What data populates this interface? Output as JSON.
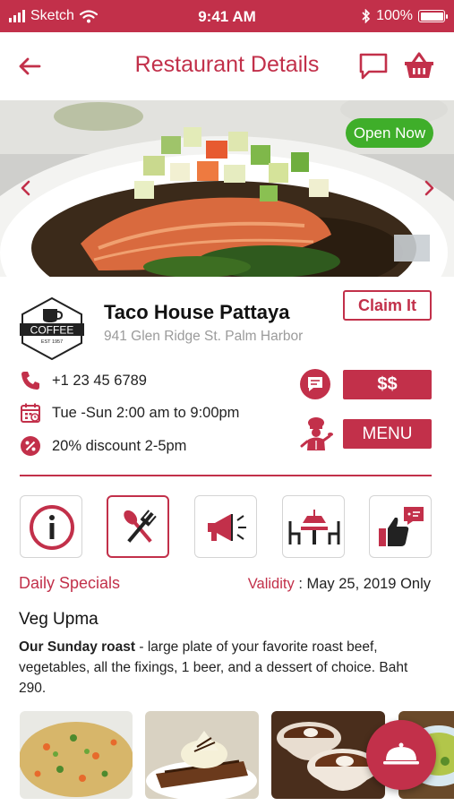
{
  "status": {
    "carrier": "Sketch",
    "time": "9:41 AM",
    "battery": "100%"
  },
  "nav": {
    "title": "Restaurant Details"
  },
  "hero": {
    "badge": "Open Now"
  },
  "restaurant": {
    "logo_text": "COFFEE",
    "logo_sub": "EST 1957",
    "name": "Taco House Pattaya",
    "address": "941 Glen Ridge St. Palm Harbor",
    "claim_label": "Claim It",
    "phone": "+1 23 45 6789",
    "hours": "Tue -Sun 2:00 am to 9:00pm",
    "discount": "20% discount 2-5pm",
    "price_label": "$$",
    "menu_label": "MENU"
  },
  "icons": {
    "tiles": [
      "info-icon",
      "cutlery-icon",
      "megaphone-icon",
      "table-icon",
      "thumbs-up-icon"
    ],
    "fab": "cloche-icon"
  },
  "specials": {
    "title": "Daily Specials",
    "validity_label": "Validity",
    "validity_sep": " : ",
    "validity_value": "May 25, 2019 Only",
    "dish_name": "Veg Upma",
    "dish_lead": "Our Sunday roast",
    "dish_text": " - large plate of your favorite roast beef, vegetables, all the fixings, 1 beer, and a dessert of choice. Baht 290."
  },
  "colors": {
    "accent": "#c2304a",
    "open": "#3fae2a",
    "muted": "#9b9b9b"
  }
}
